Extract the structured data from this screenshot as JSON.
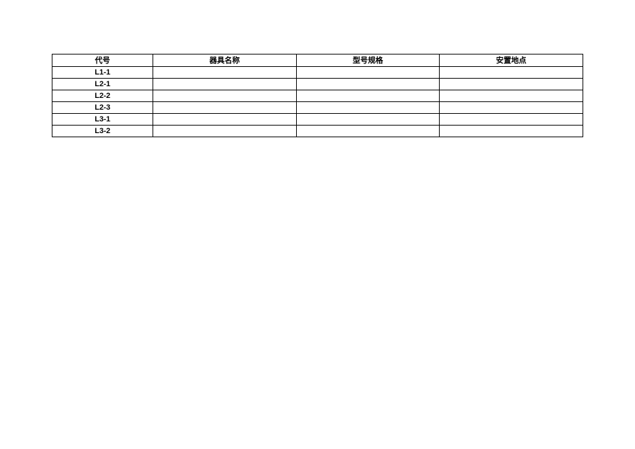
{
  "table": {
    "headers": [
      "代号",
      "器具名称",
      "型号规格",
      "安置地点"
    ],
    "rows": [
      {
        "code": "L1-1",
        "name": "",
        "spec": "",
        "loc": ""
      },
      {
        "code": "L2-1",
        "name": "",
        "spec": "",
        "loc": ""
      },
      {
        "code": "L2-2",
        "name": "",
        "spec": "",
        "loc": ""
      },
      {
        "code": "L2-3",
        "name": "",
        "spec": "",
        "loc": ""
      },
      {
        "code": "L3-1",
        "name": "",
        "spec": "",
        "loc": ""
      },
      {
        "code": "L3-2",
        "name": "",
        "spec": "",
        "loc": ""
      }
    ]
  }
}
